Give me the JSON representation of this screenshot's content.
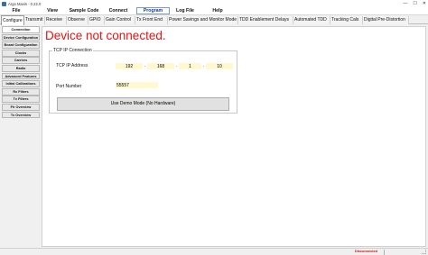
{
  "window": {
    "title": "Argo Mavis - 0.22.0",
    "minimize": "—",
    "maximize": "☐",
    "close": "✕"
  },
  "menu": [
    {
      "label": "File"
    },
    {
      "label": "View"
    },
    {
      "label": "Sample Code"
    },
    {
      "label": "Connect"
    },
    {
      "label": "Program"
    },
    {
      "label": "Log File"
    },
    {
      "label": "Help"
    }
  ],
  "tabs": [
    {
      "label": "Configure"
    },
    {
      "label": "Transmit"
    },
    {
      "label": "Receive"
    },
    {
      "label": "Observe"
    },
    {
      "label": "GPIO"
    },
    {
      "label": "Gain Control"
    },
    {
      "label": "Tx Front End"
    },
    {
      "label": "Power Savings and Monitor Mode"
    },
    {
      "label": "TDD Enablement Delays"
    },
    {
      "label": "Automated TDD"
    },
    {
      "label": "Tracking Cals"
    },
    {
      "label": "Digital Pre-Distortion"
    }
  ],
  "sidebar": [
    {
      "label": "Connection"
    },
    {
      "label": "Device Configuration"
    },
    {
      "label": "Board Configuration"
    },
    {
      "label": "Clocks"
    },
    {
      "label": "Carriers"
    },
    {
      "label": "Radio"
    },
    {
      "label": "Advanced Features"
    },
    {
      "label": "Initial Calibrations"
    },
    {
      "label": "Rx Filters"
    },
    {
      "label": "Tx Filters"
    },
    {
      "label": "Fir Overview"
    },
    {
      "label": "Tx Overview"
    }
  ],
  "main": {
    "status_title": "Device not connected.",
    "connection": {
      "group_title": "TCP IP Connection",
      "ip_label": "TCP IP Address",
      "ip": [
        "192",
        "168",
        "1",
        "10"
      ],
      "port_label": "Port Number",
      "port": "55557",
      "demo_button": "Use Demo Mode (No Hardware)"
    }
  },
  "statusbar": {
    "connection": "Disconnected"
  },
  "colors": {
    "error": "#ee1111",
    "input_bg": "#fff8d0",
    "active_menu_border": "#7a9ccf"
  }
}
